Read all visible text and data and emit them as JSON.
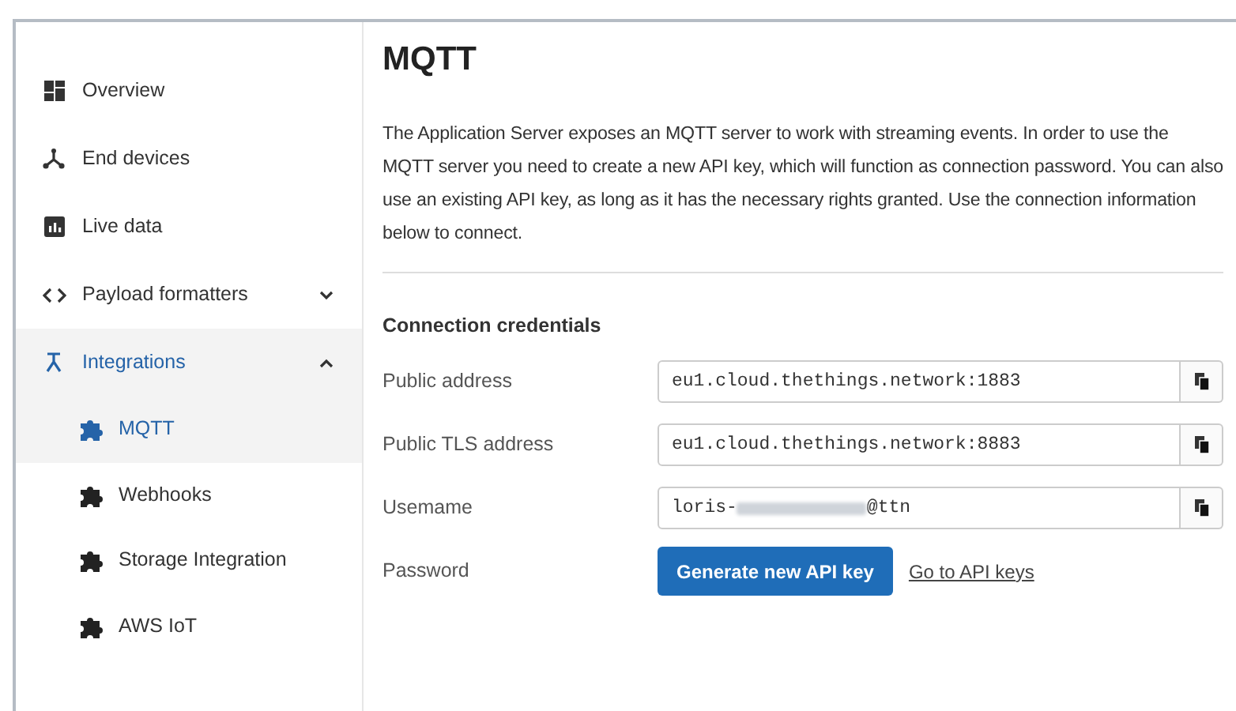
{
  "sidebar": {
    "items": [
      {
        "label": "Overview",
        "selected": false
      },
      {
        "label": "End devices",
        "selected": false
      },
      {
        "label": "Live data",
        "selected": false
      },
      {
        "label": "Payload formatters",
        "selected": false,
        "expanded": false
      },
      {
        "label": "Integrations",
        "selected": true,
        "expanded": true,
        "children": [
          {
            "label": "MQTT",
            "selected": true
          },
          {
            "label": "Webhooks",
            "selected": false
          },
          {
            "label": "Storage Integration",
            "selected": false
          },
          {
            "label": "AWS IoT",
            "selected": false
          }
        ]
      }
    ]
  },
  "main": {
    "title": "MQTT",
    "description": "The Application Server exposes an MQTT server to work with streaming events. In order to use the MQTT server you need to create a new API key, which will function as connection password. You can also use an existing API key, as long as it has the necessary rights granted. Use the connection information below to connect.",
    "section_title": "Connection credentials",
    "fields": [
      {
        "kind": "copy",
        "label": "Public address",
        "value": "eu1.cloud.thethings.network:1883"
      },
      {
        "kind": "copy",
        "label": "Public TLS address",
        "value": "eu1.cloud.thethings.network:8883"
      },
      {
        "kind": "redacted",
        "label": "Usemame",
        "value_start": "loris-",
        "value_end": "@ttn"
      },
      {
        "kind": "actions",
        "label": "Password",
        "button": "Generate new API key",
        "link": "Go to API keys"
      }
    ]
  }
}
